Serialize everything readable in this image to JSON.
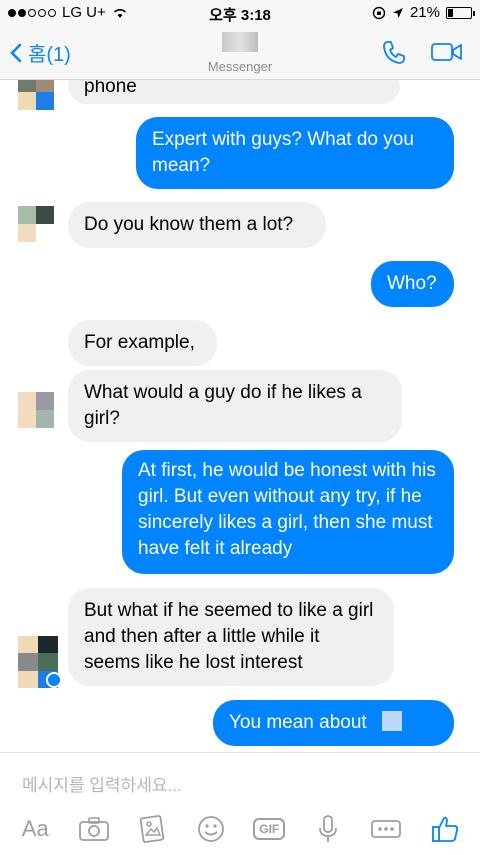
{
  "status_bar": {
    "carrier": "LG U+",
    "time": "오후 3:18",
    "battery": "21%",
    "battery_level": 0.21
  },
  "nav": {
    "back_label": "홈(1)",
    "subtitle": "Messenger"
  },
  "messages": [
    {
      "from": "them",
      "text": "phone"
    },
    {
      "from": "me",
      "text": "Expert with guys? What do you mean?"
    },
    {
      "from": "them",
      "text": "Do you know them a lot?"
    },
    {
      "from": "me",
      "text": "Who?"
    },
    {
      "from": "them",
      "text": "For example,"
    },
    {
      "from": "them",
      "text": "What would a guy do if he likes a girl?"
    },
    {
      "from": "me",
      "text": "At first, he would be honest with his girl. But even without any try, if he sincerely likes a girl, then she must have felt it already"
    },
    {
      "from": "them",
      "text": "But what if he seemed to like a girl and then after a little while it seems like he lost interest"
    },
    {
      "from": "me",
      "text": "You mean about"
    }
  ],
  "composer": {
    "placeholder": "메시지를 입력하세요...",
    "text_tool_label": "Aa",
    "gif_label": "GIF"
  },
  "toolbar_icons": [
    "text-format-icon",
    "camera-icon",
    "gallery-icon",
    "emoji-icon",
    "gif-icon",
    "microphone-icon",
    "more-icon",
    "like-icon"
  ],
  "colors": {
    "accent": "#0084ff",
    "incoming_bubble": "#f1f0f0",
    "nav_icon": "#0a84ff"
  }
}
